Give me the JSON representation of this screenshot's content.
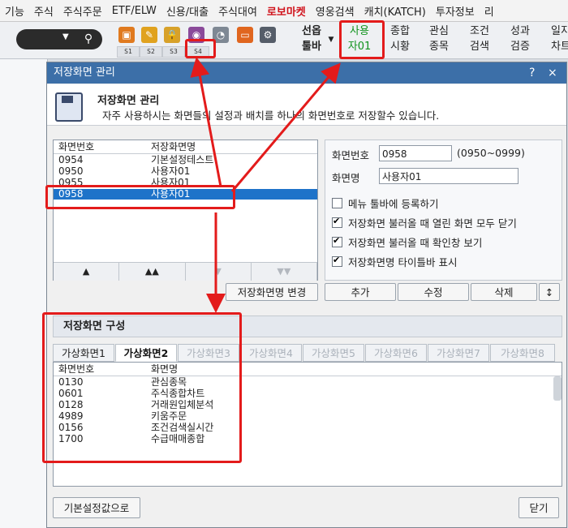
{
  "menubar": {
    "items": [
      "기능",
      "주식",
      "주식주문",
      "ETF/ELW",
      "신용/대출",
      "주식대여",
      "로보마켓",
      "영웅검색",
      "캐치(KATCH)",
      "투자정보",
      "리"
    ]
  },
  "toolbar": {
    "slots": [
      "S1",
      "S2",
      "S3",
      "S4"
    ],
    "buttons": [
      {
        "l1": "선옵",
        "l2": "툴바"
      },
      {
        "l1": "사용",
        "l2": "자01"
      },
      {
        "l1": "종합",
        "l2": "시황"
      },
      {
        "l1": "관심",
        "l2": "종목"
      },
      {
        "l1": "조건",
        "l2": "검색"
      },
      {
        "l1": "성과",
        "l2": "검증"
      },
      {
        "l1": "일지",
        "l2": "차트"
      }
    ]
  },
  "dialog": {
    "title": "저장화면 관리",
    "help": "?",
    "close": "×",
    "header_title": "저장화면 관리",
    "header_desc": "자주 사용하시는 화면들의 설정과 배치를 하나의 화면번호로 저장할수 있습니다.",
    "list": {
      "col_no": "화면번호",
      "col_name": "저장화면명",
      "rows": [
        {
          "no": "0954",
          "name": "기본설정테스트"
        },
        {
          "no": "0950",
          "name": "사용자01"
        },
        {
          "no": "0955",
          "name": "사용자01"
        },
        {
          "no": "0958",
          "name": "사용자01"
        }
      ],
      "arrows": [
        "▲",
        "▲▲",
        "▼",
        "▼▼"
      ]
    },
    "form": {
      "no_label": "화면번호",
      "no_value": "0958",
      "range": "(0950~0999)",
      "name_label": "화면명",
      "name_value": "사용자01",
      "checks": [
        {
          "label": "메뉴 툴바에 등록하기",
          "checked": false
        },
        {
          "label": "저장화면 불러올 때 열린 화면 모두 닫기",
          "checked": true
        },
        {
          "label": "저장화면 불러올 때 확인창 보기",
          "checked": true
        },
        {
          "label": "저장화면명 타이틀바 표시",
          "checked": true
        }
      ]
    },
    "buttons": {
      "rename": "저장화면명 변경",
      "add": "추가",
      "edit": "수정",
      "delete": "삭제",
      "sort": "↕",
      "defaults": "기본설정값으로",
      "close": "닫기"
    },
    "composition": {
      "title": "저장화면 구성",
      "tabs": [
        "가상화면1",
        "가상화면2",
        "가상화면3",
        "가상화면4",
        "가상화면5",
        "가상화면6",
        "가상화면7",
        "가상화면8"
      ],
      "col_no": "화면번호",
      "col_name": "화면명",
      "rows": [
        {
          "no": "0130",
          "name": "관심종목"
        },
        {
          "no": "0601",
          "name": "주식종합차트"
        },
        {
          "no": "0128",
          "name": "거래원입체분석"
        },
        {
          "no": "4989",
          "name": "키움주문"
        },
        {
          "no": "0156",
          "name": "조건검색실시간"
        },
        {
          "no": "1700",
          "name": "수급매매종합"
        }
      ]
    }
  },
  "colors": {
    "title_bar": "#3c6fa8",
    "selection": "#1e73c9",
    "annotation": "#e31b1b",
    "accent_green": "#10931d"
  }
}
